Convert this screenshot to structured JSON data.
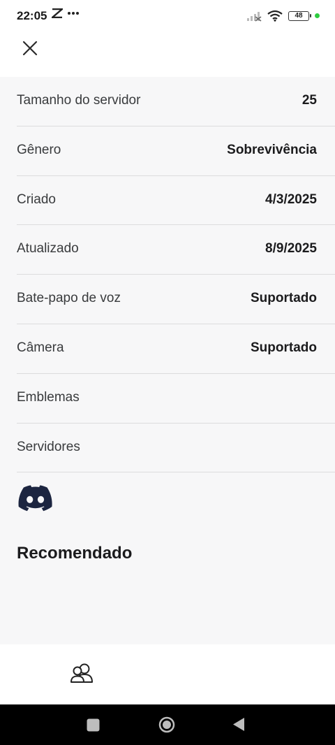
{
  "status_bar": {
    "time": "22:05",
    "battery": "48"
  },
  "details": [
    {
      "label": "Tamanho do servidor",
      "value": "25"
    },
    {
      "label": "Gênero",
      "value": "Sobrevivência"
    },
    {
      "label": "Criado",
      "value": "4/3/2025"
    },
    {
      "label": "Atualizado",
      "value": "8/9/2025"
    },
    {
      "label": "Bate-papo de voz",
      "value": "Suportado"
    },
    {
      "label": "Câmera",
      "value": "Suportado"
    },
    {
      "label": "Emblemas",
      "value": ""
    },
    {
      "label": "Servidores",
      "value": ""
    }
  ],
  "social": {
    "icon": "discord-icon",
    "color": "#1c2540"
  },
  "section": {
    "title": "Recomendado"
  },
  "bottom_nav": {
    "icon": "friends-icon"
  },
  "colors": {
    "accent_green": "#2ecc40",
    "background": "#f7f7f8",
    "divider": "#dcdcdd"
  }
}
